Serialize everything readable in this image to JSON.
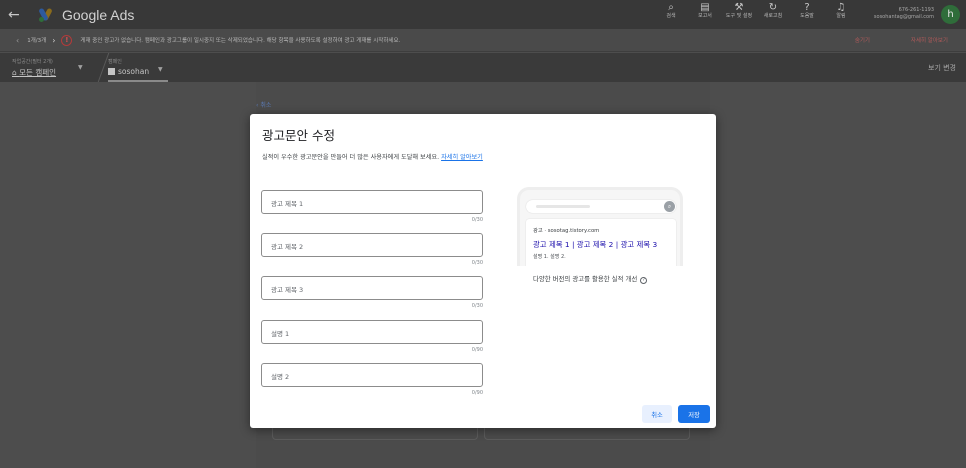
{
  "topbar": {
    "title": "Google Ads",
    "back_icon": "arrow-left-icon",
    "tools": [
      {
        "icon": "search-icon",
        "glyph": "⌕",
        "label": "검색"
      },
      {
        "icon": "report-icon",
        "glyph": "▤",
        "label": "보고서"
      },
      {
        "icon": "wrench-icon",
        "glyph": "⚒",
        "label": "도구 및 설정"
      },
      {
        "icon": "refresh-icon",
        "glyph": "↻",
        "label": "새로고침"
      },
      {
        "icon": "help-icon",
        "glyph": "?",
        "label": "도움말"
      },
      {
        "icon": "bell-icon",
        "glyph": "♫",
        "label": "알림"
      }
    ],
    "account_id": "676-261-1193",
    "account_email": "sosohantag@gmail.com",
    "avatar_letter": "h"
  },
  "notice": {
    "pager": "1개/3개",
    "message": "게재 중인 광고가 없습니다. 캠페인과 광고그룹이 일시중지 또는 삭제되었습니다. 해당 항목을 사용하도록 설정하여 광고 게재를 시작하세요.",
    "hide_label": "숨기기",
    "learn_more_label": "자세히 알아보기"
  },
  "nav": {
    "workspace_label": "작업공간(필터 2개)",
    "workspace_value": "모든 캠페인",
    "campaign_label": "캠페인",
    "campaign_value": "sosohan",
    "view_change": "보기 변경"
  },
  "background": {
    "cancel_link": "취소"
  },
  "modal": {
    "title": "광고문안 수정",
    "subtitle": "실적이 우수한 광고문안을 만들어 더 많은 사용자에게 도달해 보세요.",
    "subtitle_link": "자세히 알아보기",
    "fields": [
      {
        "placeholder": "광고 제목 1",
        "counter": "0/30"
      },
      {
        "placeholder": "광고 제목 2",
        "counter": "0/30"
      },
      {
        "placeholder": "광고 제목 3",
        "counter": "0/30"
      },
      {
        "placeholder": "설명 1",
        "counter": "0/90"
      },
      {
        "placeholder": "설명 2",
        "counter": "0/90"
      }
    ],
    "preview": {
      "url": "광고 · sosotag.tistory.com",
      "headline": "광고 제목 1 | 광고 제목 2 | 광고 제목 3",
      "description": "설명 1. 설명 2.",
      "caption": "다양한 버전의 광고를 활용한 실적 개선"
    },
    "cancel_label": "취소",
    "save_label": "저장"
  },
  "colors": {
    "primary": "#1a73e8",
    "link": "#1a0dab",
    "avatar": "#2f6d3a"
  }
}
